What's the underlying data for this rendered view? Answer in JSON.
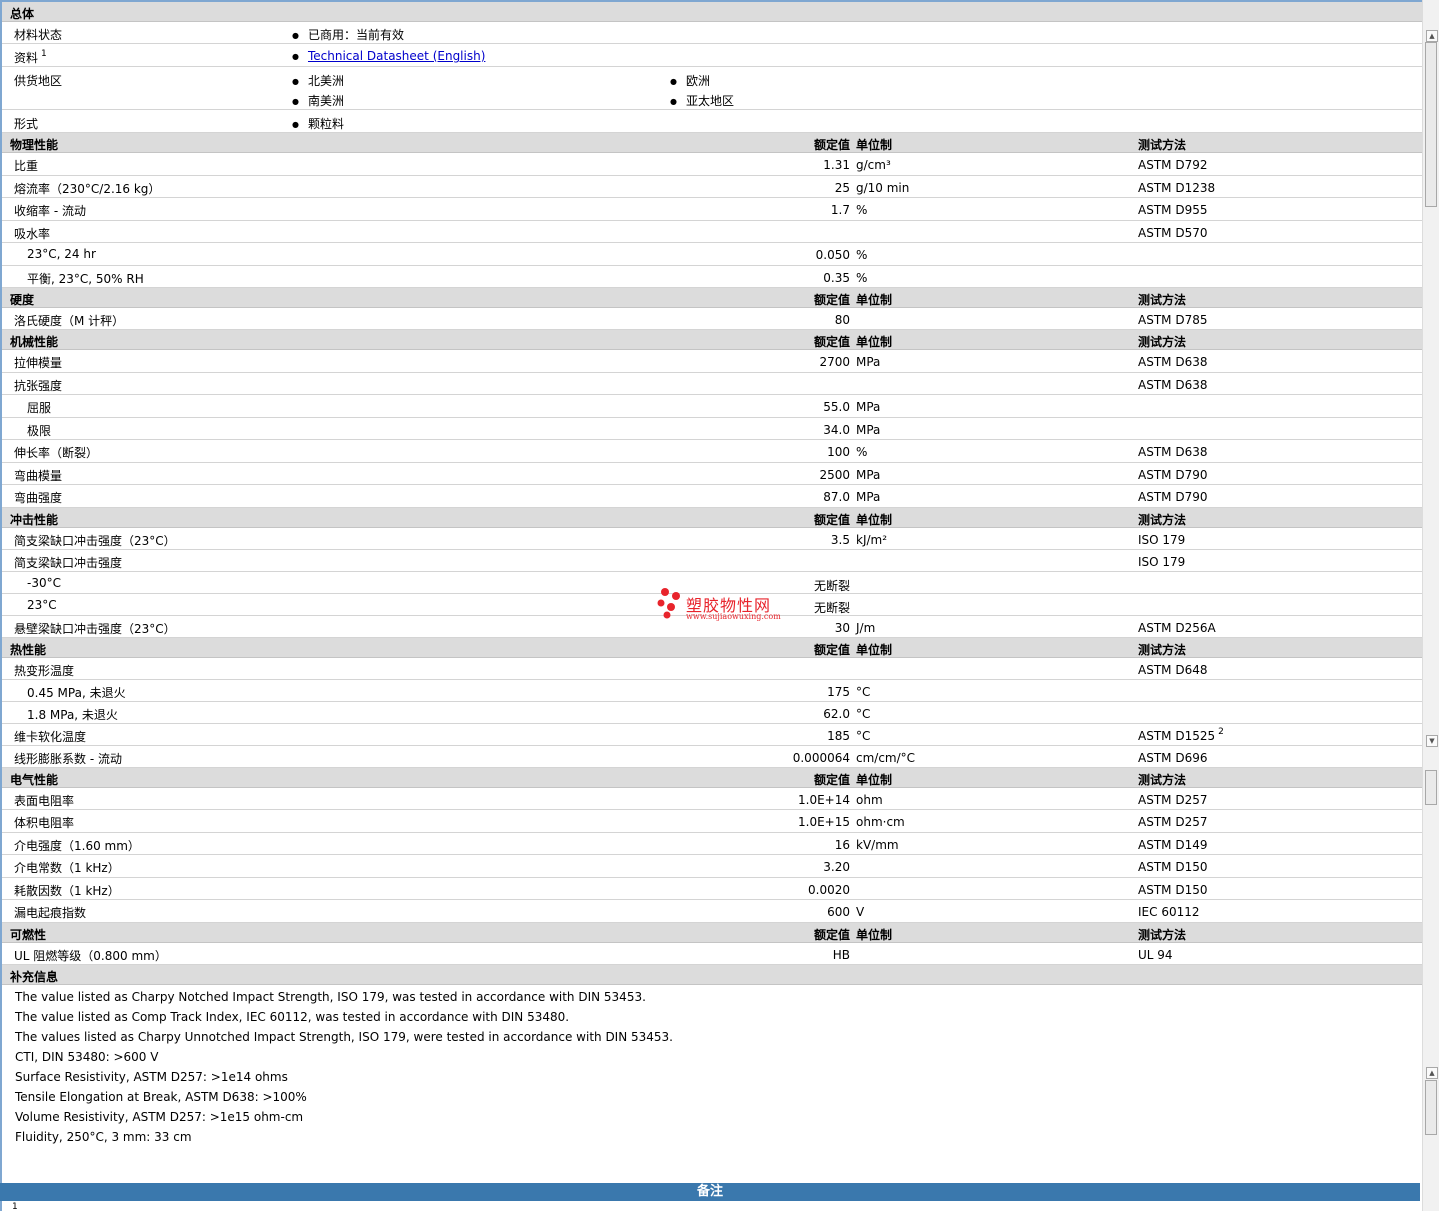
{
  "headers": {
    "value": "额定值",
    "unit": "单位制",
    "method": "测试方法"
  },
  "general": {
    "title": "总体",
    "status": {
      "label": "材料状态",
      "value": "已商用：当前有效"
    },
    "docs": {
      "label": "资料",
      "sup": "1",
      "link": "Technical Datasheet (English)"
    },
    "regions": {
      "label": "供货地区",
      "r1": "北美洲",
      "r2": "欧洲",
      "r3": "南美洲",
      "r4": "亚太地区"
    },
    "form": {
      "label": "形式",
      "value": "颗粒料"
    }
  },
  "sections": [
    {
      "title": "物理性能",
      "rows": [
        {
          "label": "比重",
          "value": "1.31",
          "unit": "g/cm³",
          "method": "ASTM D792"
        },
        {
          "label": "熔流率（230°C/2.16 kg）",
          "value": "25",
          "unit": "g/10 min",
          "method": "ASTM D1238"
        },
        {
          "label": "收缩率 - 流动",
          "value": "1.7",
          "unit": "%",
          "method": "ASTM D955"
        },
        {
          "label": "吸水率",
          "value": "",
          "unit": "",
          "method": "ASTM D570"
        },
        {
          "label": "23°C, 24 hr",
          "value": "0.050",
          "unit": "%",
          "method": "",
          "sub": true
        },
        {
          "label": "平衡, 23°C, 50% RH",
          "value": "0.35",
          "unit": "%",
          "method": "",
          "sub": true
        }
      ]
    },
    {
      "title": "硬度",
      "rows": [
        {
          "label": "洛氏硬度（M 计秤）",
          "value": "80",
          "unit": "",
          "method": "ASTM D785"
        }
      ]
    },
    {
      "title": "机械性能",
      "rows": [
        {
          "label": "拉伸模量",
          "value": "2700",
          "unit": "MPa",
          "method": "ASTM D638"
        },
        {
          "label": "抗张强度",
          "value": "",
          "unit": "",
          "method": "ASTM D638"
        },
        {
          "label": "屈服",
          "value": "55.0",
          "unit": "MPa",
          "method": "",
          "sub": true
        },
        {
          "label": "极限",
          "value": "34.0",
          "unit": "MPa",
          "method": "",
          "sub": true
        },
        {
          "label": "伸长率（断裂）",
          "value": "100",
          "unit": "%",
          "method": "ASTM D638"
        },
        {
          "label": "弯曲模量",
          "value": "2500",
          "unit": "MPa",
          "method": "ASTM D790"
        },
        {
          "label": "弯曲强度",
          "value": "87.0",
          "unit": "MPa",
          "method": "ASTM D790"
        }
      ]
    },
    {
      "title": "冲击性能",
      "rows": [
        {
          "label": "简支梁缺口冲击强度（23°C）",
          "value": "3.5",
          "unit": "kJ/m²",
          "method": "ISO 179"
        },
        {
          "label": "简支梁缺口冲击强度",
          "value": "",
          "unit": "",
          "method": "ISO 179"
        },
        {
          "label": "-30°C",
          "value": "无断裂",
          "unit": "",
          "method": "",
          "sub": true
        },
        {
          "label": "23°C",
          "value": "无断裂",
          "unit": "",
          "method": "",
          "sub": true
        },
        {
          "label": "悬壁梁缺口冲击强度（23°C）",
          "value": "30",
          "unit": "J/m",
          "method": "ASTM D256A"
        }
      ]
    },
    {
      "title": "热性能",
      "rows": [
        {
          "label": "热变形温度",
          "value": "",
          "unit": "",
          "method": "ASTM D648"
        },
        {
          "label": "0.45 MPa, 未退火",
          "value": "175",
          "unit": "°C",
          "method": "",
          "sub": true
        },
        {
          "label": "1.8 MPa, 未退火",
          "value": "62.0",
          "unit": "°C",
          "method": "",
          "sub": true
        },
        {
          "label": "维卡软化温度",
          "value": "185",
          "unit": "°C",
          "method": "ASTM D1525",
          "sup": "2"
        },
        {
          "label": "线形膨胀系数 - 流动",
          "value": "0.000064",
          "unit": "cm/cm/°C",
          "method": "ASTM D696"
        }
      ]
    },
    {
      "title": "电气性能",
      "rows": [
        {
          "label": "表面电阻率",
          "value": "1.0E+14",
          "unit": "ohm",
          "method": "ASTM D257"
        },
        {
          "label": "体积电阻率",
          "value": "1.0E+15",
          "unit": "ohm·cm",
          "method": "ASTM D257"
        },
        {
          "label": "介电强度（1.60 mm）",
          "value": "16",
          "unit": "kV/mm",
          "method": "ASTM D149"
        },
        {
          "label": "介电常数（1 kHz）",
          "value": "3.20",
          "unit": "",
          "method": "ASTM D150"
        },
        {
          "label": "耗散因数（1 kHz）",
          "value": "0.0020",
          "unit": "",
          "method": "ASTM D150"
        },
        {
          "label": "漏电起痕指数",
          "value": "600",
          "unit": "V",
          "method": "IEC 60112"
        }
      ]
    },
    {
      "title": "可燃性",
      "rows": [
        {
          "label": "UL 阻燃等级（0.800 mm）",
          "value": "HB",
          "unit": "",
          "method": "UL 94"
        }
      ]
    }
  ],
  "supplemental": {
    "title": "补充信息",
    "lines": [
      "The value listed as Charpy Notched Impact Strength, ISO 179, was tested in accordance with DIN 53453.",
      "The value listed as Comp Track Index, IEC 60112, was tested in accordance with DIN 53480.",
      "The values listed as Charpy Unnotched Impact Strength, ISO 179, were tested in accordance with DIN 53453.",
      "CTI, DIN 53480: >600 V",
      "Surface Resistivity, ASTM D257: >1e14 ohms",
      "Tensile Elongation at Break, ASTM D638: >100%",
      "Volume Resistivity, ASTM D257: >1e15 ohm-cm",
      "Fluidity, 250°C, 3 mm: 33 cm"
    ]
  },
  "notes": {
    "title": "备注",
    "first": "1"
  },
  "watermark": {
    "title": "塑胶物性网",
    "sub": "www.sujiaowuxing.com",
    "color": "#e8242c"
  }
}
